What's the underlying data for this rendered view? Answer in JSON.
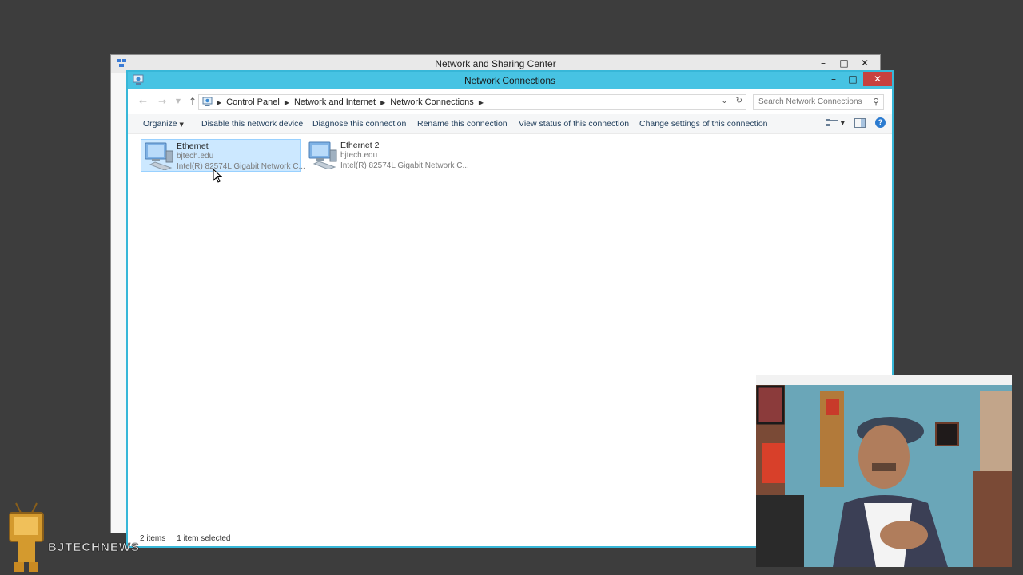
{
  "back_window": {
    "title": "Network and Sharing Center"
  },
  "front_window": {
    "title": "Network Connections"
  },
  "address_bar": {
    "crumbs": [
      "Control Panel",
      "Network and Internet",
      "Network Connections"
    ]
  },
  "search": {
    "placeholder": "Search Network Connections"
  },
  "toolbar": {
    "organize": "Organize",
    "disable": "Disable this network device",
    "diagnose": "Diagnose this connection",
    "rename": "Rename this connection",
    "view_status": "View status of this connection",
    "change_settings": "Change settings of this connection"
  },
  "connections": [
    {
      "name": "Ethernet",
      "domain": "bjtech.edu",
      "adapter": "Intel(R) 82574L Gigabit Network C...",
      "selected": true
    },
    {
      "name": "Ethernet 2",
      "domain": "bjtech.edu",
      "adapter": "Intel(R) 82574L Gigabit Network C...",
      "selected": false
    }
  ],
  "status": {
    "item_count": "2 items",
    "selection": "1 item selected"
  },
  "colors": {
    "accent_border": "#37b7d8",
    "title_active": "#47c3e3",
    "selection": "#cce8ff",
    "close_button": "#c7413f"
  },
  "icons": [
    "network-adapter-icon",
    "control-panel-icon",
    "search-icon",
    "refresh-icon",
    "help-icon",
    "preview-pane-icon",
    "view-options-icon"
  ]
}
